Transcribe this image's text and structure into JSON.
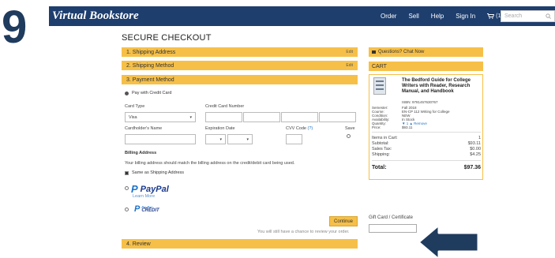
{
  "step_number": "9",
  "navbar": {
    "brand": "Virtual Bookstore",
    "links": [
      "Order",
      "Sell",
      "Help",
      "Sign In"
    ],
    "cart_count": "(1)",
    "search_placeholder": "Search"
  },
  "page_title": "SECURE CHECKOUT",
  "steps": {
    "shipping_address": "1. Shipping Address",
    "shipping_method": "2. Shipping Method",
    "payment_method": "3. Payment Method",
    "review": "4. Review",
    "edit_label": "Edit"
  },
  "payment": {
    "pay_credit_label": "Pay with Credit Card",
    "card_type_label": "Card Type",
    "card_type_value": "Visa",
    "card_number_label": "Credit Card Number",
    "cardholder_label": "Cardholder's Name",
    "expiration_label": "Expiration Date",
    "cvv_label": "CVV Code",
    "cvv_help": "(?)",
    "save_label": "Save",
    "billing_heading": "Billing Address",
    "billing_note": "Your billing address should match the billing address on the credit/debit card being used.",
    "same_as_shipping": "Same as Shipping Address",
    "paypal_label": "PayPal",
    "paypal_learn_more": "Learn More",
    "paypal_credit_top": "PayPal",
    "paypal_credit_bottom": "CREDIT",
    "continue_label": "Continue",
    "review_note": "You will still have a chance to review your order."
  },
  "sidebar": {
    "questions": "Questions? Chat Now",
    "cart_heading": "CART",
    "book_title": "The Bedford Guide for College Writers with Reader, Research Manual, and Handbook",
    "isbn": "ISBN: 9781457630767",
    "meta": [
      {
        "k": "Semester:",
        "v": "Fall 2018"
      },
      {
        "k": "Course:",
        "v": "EN-CP 112 Writing for College"
      },
      {
        "k": "Condition:",
        "v": "NEW"
      },
      {
        "k": "Availability:",
        "v": "In Stock"
      },
      {
        "k": "Quantity:",
        "v": "▼ 1 ▲ Remove"
      },
      {
        "k": "Price:",
        "v": "$93.11"
      }
    ],
    "totals": [
      {
        "k": "Items in Cart:",
        "v": "1"
      },
      {
        "k": "Subtotal:",
        "v": "$93.11"
      },
      {
        "k": "Sales Tax:",
        "v": "$0.00"
      },
      {
        "k": "Shipping:",
        "v": "$4.25"
      }
    ],
    "total_label": "Total:",
    "total_value": "$97.36",
    "gift_label": "Gift Card / Certificate"
  },
  "colors": {
    "navbar": "#1e3e6e",
    "accent": "#f6c048",
    "arrow": "#1f3b5e"
  }
}
